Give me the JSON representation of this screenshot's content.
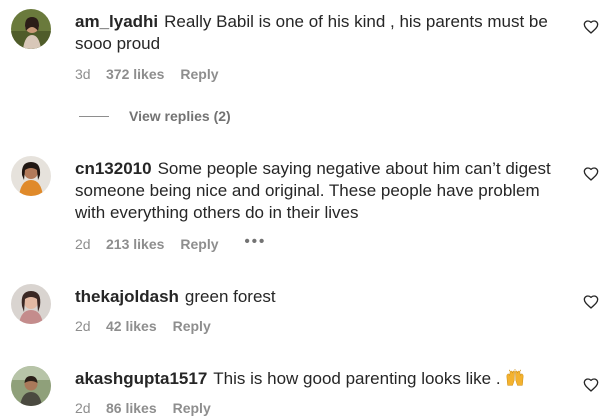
{
  "comments": [
    {
      "username": "am_lyadhi",
      "text": "Really Babil is one of his kind , his parents must be sooo proud",
      "time": "3d",
      "likes": "372 likes",
      "reply": "Reply",
      "view_replies": "View replies (2)"
    },
    {
      "username": "cn132010",
      "text": "Some people saying negative about him can’t digest someone being nice and original. These people have problem with everything others do in their lives",
      "time": "2d",
      "likes": "213 likes",
      "reply": "Reply",
      "more": "•••"
    },
    {
      "username": "thekajoldash",
      "text": "green forest",
      "time": "2d",
      "likes": "42 likes",
      "reply": "Reply"
    },
    {
      "username": "akashgupta1517",
      "text": "This is how good parenting looks like .",
      "time": "2d",
      "likes": "86 likes",
      "reply": "Reply",
      "emoji": "raising-hands-icon"
    }
  ],
  "colors": {
    "text": "#262626",
    "meta": "#8e8e8e"
  }
}
